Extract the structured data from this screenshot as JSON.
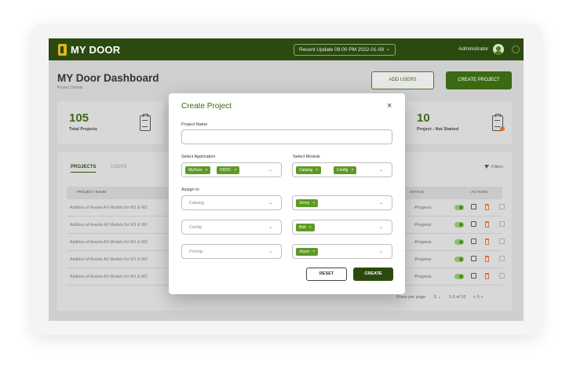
{
  "header": {
    "logo_text": "MY DOOR",
    "recent_update": "Recent Update 09:00 PM 2022-01-09",
    "user_name": "Administrator"
  },
  "page": {
    "title": "MY Door Dashboard",
    "subtitle": "Project Details",
    "add_users_label": "ADD USERS",
    "create_project_label": "CREATE PROJECT"
  },
  "stats": [
    {
      "value": "105",
      "label": "Total Projects"
    },
    {
      "value": "10",
      "label": "Project - Not Started"
    }
  ],
  "projects_panel": {
    "tabs": [
      "PROJECTS",
      "USERS"
    ],
    "filters_label": "Filters",
    "columns": [
      "PROJECT NAME",
      "STATUS",
      "ACTIONS"
    ],
    "rows": [
      {
        "name": "Addition of Avante AX Models for W1 & W2",
        "status": "-Progress"
      },
      {
        "name": "Addition of Avante AX Models for W1 & W2",
        "status": "-Progress"
      },
      {
        "name": "Addition of Avante AX Models for W1 & W2",
        "status": "-Progress"
      },
      {
        "name": "Addition of Avante AX Models for W1 & W2",
        "status": "-Progress"
      },
      {
        "name": "Addition of Avante AX Models for W1 & W2",
        "status": "-Progress"
      }
    ],
    "pagination": {
      "rows_per_page_label": "Rows per page:",
      "rows_per_page_value": "5",
      "range": "1-5 of 10",
      "prev": "<",
      "page": "5",
      "next": ">"
    }
  },
  "modal": {
    "title": "Create Project",
    "close_glyph": "×",
    "project_name_label": "Project Name",
    "project_name_value": "",
    "select_application_label": "Select Application",
    "applications": [
      "MyDoor",
      "HDDC"
    ],
    "select_module_label": "Select Module",
    "modules": [
      "Catalog",
      "Config"
    ],
    "assign_to_label": "Assign to",
    "assignments": [
      {
        "module": "Catalog",
        "user": "Jenny"
      },
      {
        "module": "Config",
        "user": "Bob"
      },
      {
        "module": "Pricing",
        "user": "Joyce"
      }
    ],
    "reset_label": "RESET",
    "create_label": "CREATE"
  },
  "colors": {
    "brand_dark": "#2c4a10",
    "brand_green": "#3f6a16",
    "chip_green": "#5d9a24",
    "accent_orange": "#e07020"
  }
}
